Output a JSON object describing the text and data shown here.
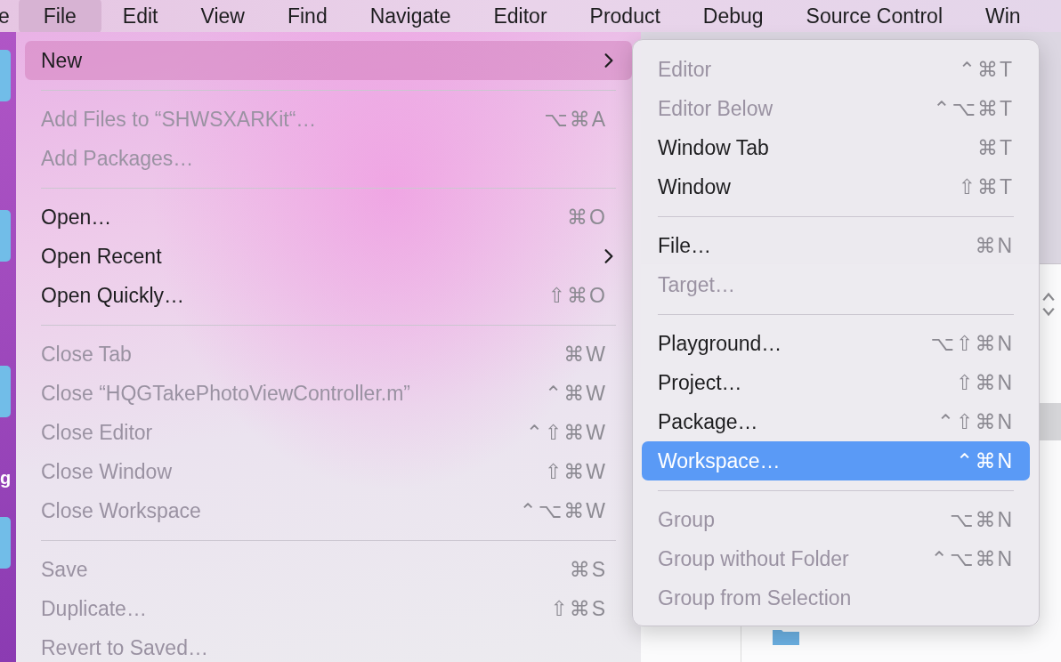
{
  "menu_bar": [
    {
      "label": "e",
      "selected": false
    },
    {
      "label": "File",
      "selected": true
    },
    {
      "label": "Edit",
      "selected": false
    },
    {
      "label": "View",
      "selected": false
    },
    {
      "label": "Find",
      "selected": false
    },
    {
      "label": "Navigate",
      "selected": false
    },
    {
      "label": "Editor",
      "selected": false
    },
    {
      "label": "Product",
      "selected": false
    },
    {
      "label": "Debug",
      "selected": false
    },
    {
      "label": "Source Control",
      "selected": false
    },
    {
      "label": "Win",
      "selected": false
    }
  ],
  "desktop": {
    "icon_label": "g"
  },
  "file_menu": [
    {
      "kind": "item",
      "label": "New",
      "disabled": false,
      "selected": true,
      "submenu": true
    },
    {
      "kind": "separator"
    },
    {
      "kind": "item",
      "label": "Add Files to “SHWSXARKit“…",
      "shortcut": "⌥⌘A",
      "disabled": true,
      "selected": false,
      "submenu": false
    },
    {
      "kind": "item",
      "label": "Add Packages…",
      "disabled": true,
      "selected": false,
      "submenu": false
    },
    {
      "kind": "separator"
    },
    {
      "kind": "item",
      "label": "Open…",
      "shortcut": "⌘O",
      "disabled": false,
      "selected": false,
      "submenu": false
    },
    {
      "kind": "item",
      "label": "Open Recent",
      "disabled": false,
      "selected": false,
      "submenu": true
    },
    {
      "kind": "item",
      "label": "Open Quickly…",
      "shortcut": "⇧⌘O",
      "disabled": false,
      "selected": false,
      "submenu": false
    },
    {
      "kind": "separator"
    },
    {
      "kind": "item",
      "label": "Close Tab",
      "shortcut": "⌘W",
      "disabled": true,
      "selected": false,
      "submenu": false
    },
    {
      "kind": "item",
      "label": "Close “HQGTakePhotoViewController.m”",
      "shortcut": "⌃⌘W",
      "disabled": true,
      "selected": false,
      "submenu": false
    },
    {
      "kind": "item",
      "label": "Close Editor",
      "shortcut": "⌃⇧⌘W",
      "disabled": true,
      "selected": false,
      "submenu": false
    },
    {
      "kind": "item",
      "label": "Close Window",
      "shortcut": "⇧⌘W",
      "disabled": true,
      "selected": false,
      "submenu": false
    },
    {
      "kind": "item",
      "label": "Close Workspace",
      "shortcut": "⌃⌥⌘W",
      "disabled": true,
      "selected": false,
      "submenu": false
    },
    {
      "kind": "separator"
    },
    {
      "kind": "item",
      "label": "Save",
      "shortcut": "⌘S",
      "disabled": true,
      "selected": false,
      "submenu": false
    },
    {
      "kind": "item",
      "label": "Duplicate…",
      "shortcut": "⇧⌘S",
      "disabled": true,
      "selected": false,
      "submenu": false
    },
    {
      "kind": "item",
      "label": "Revert to Saved…",
      "disabled": true,
      "selected": false,
      "submenu": false
    }
  ],
  "new_submenu": [
    {
      "kind": "item",
      "label": "Editor",
      "shortcut": "⌃⌘T",
      "disabled": true,
      "selected": false
    },
    {
      "kind": "item",
      "label": "Editor Below",
      "shortcut": "⌃⌥⌘T",
      "disabled": true,
      "selected": false
    },
    {
      "kind": "item",
      "label": "Window Tab",
      "shortcut": "⌘T",
      "disabled": false,
      "selected": false
    },
    {
      "kind": "item",
      "label": "Window",
      "shortcut": "⇧⌘T",
      "disabled": false,
      "selected": false
    },
    {
      "kind": "separator"
    },
    {
      "kind": "item",
      "label": "File…",
      "shortcut": "⌘N",
      "disabled": false,
      "selected": false
    },
    {
      "kind": "item",
      "label": "Target…",
      "disabled": true,
      "selected": false
    },
    {
      "kind": "separator"
    },
    {
      "kind": "item",
      "label": "Playground…",
      "shortcut": "⌥⇧⌘N",
      "disabled": false,
      "selected": false
    },
    {
      "kind": "item",
      "label": "Project…",
      "shortcut": "⇧⌘N",
      "disabled": false,
      "selected": false
    },
    {
      "kind": "item",
      "label": "Package…",
      "shortcut": "⌃⇧⌘N",
      "disabled": false,
      "selected": false
    },
    {
      "kind": "item",
      "label": "Workspace…",
      "shortcut": "⌃⌘N",
      "disabled": false,
      "selected": true
    },
    {
      "kind": "separator"
    },
    {
      "kind": "item",
      "label": "Group",
      "shortcut": "⌥⌘N",
      "disabled": true,
      "selected": false
    },
    {
      "kind": "item",
      "label": "Group without Folder",
      "shortcut": "⌃⌥⌘N",
      "disabled": true,
      "selected": false
    },
    {
      "kind": "item",
      "label": "Group from Selection",
      "disabled": true,
      "selected": false
    }
  ]
}
